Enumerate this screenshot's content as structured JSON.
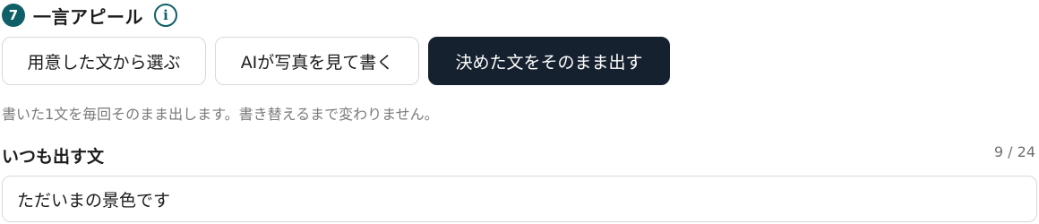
{
  "section": {
    "step_number": "7",
    "title": "一言アピール",
    "info_glyph": "i"
  },
  "modes": {
    "options": [
      {
        "label": "用意した文から選ぶ",
        "active": false
      },
      {
        "label": "AIが写真を見て書く",
        "active": false
      },
      {
        "label": "決めた文をそのまま出す",
        "active": true
      }
    ],
    "description": "書いた1文を毎回そのまま出します。書き替えるまで変わりません。"
  },
  "fixed_text": {
    "label": "いつも出す文",
    "char_count": "9 / 24",
    "value": "ただいまの景色です"
  },
  "colors": {
    "accent": "#0f5f68",
    "active_button_bg": "#15212e",
    "border": "#d6d9dc",
    "muted_text": "#7a7a7a"
  }
}
